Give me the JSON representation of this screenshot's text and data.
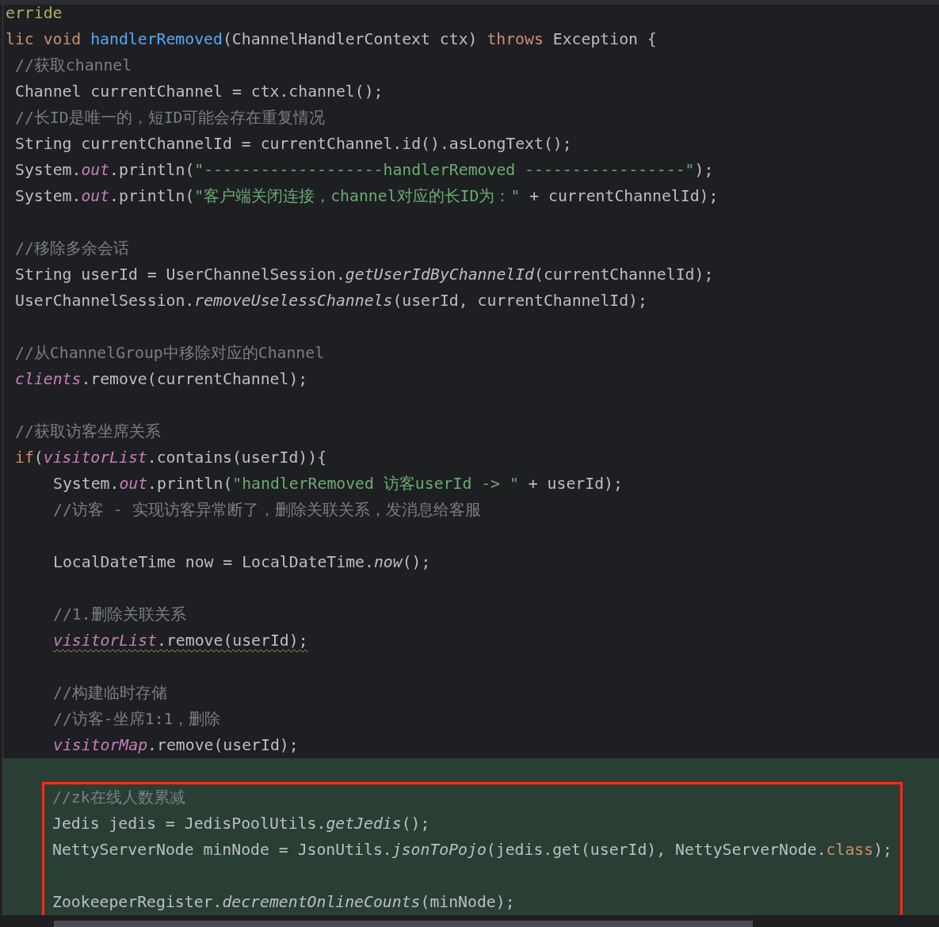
{
  "editor": {
    "lines": [
      {
        "kind": "code",
        "changed": false,
        "boxed": false,
        "tokens": [
          {
            "kind": "annotation",
            "text": "erride"
          }
        ]
      },
      {
        "kind": "code",
        "changed": false,
        "boxed": false,
        "tokens": [
          {
            "kind": "keyword",
            "text": "lic void "
          },
          {
            "kind": "declaration",
            "text": "handlerRemoved"
          },
          {
            "kind": "plain",
            "text": "(ChannelHandlerContext ctx) "
          },
          {
            "kind": "keyword",
            "text": "throws "
          },
          {
            "kind": "plain",
            "text": "Exception {"
          }
        ],
        "children": [
          {
            "kind": "code",
            "changed": false,
            "boxed": false,
            "tokens": [
              {
                "kind": "comment",
                "text": "//获取channel"
              }
            ]
          },
          {
            "kind": "code",
            "changed": false,
            "boxed": false,
            "tokens": [
              {
                "kind": "plain",
                "text": "Channel currentChannel = ctx.channel();"
              }
            ]
          },
          {
            "kind": "code",
            "changed": false,
            "boxed": false,
            "tokens": [
              {
                "kind": "comment",
                "text": "//长ID是唯一的，短ID可能会存在重复情况"
              }
            ]
          },
          {
            "kind": "code",
            "changed": false,
            "boxed": false,
            "tokens": [
              {
                "kind": "plain",
                "text": "String currentChannelId = currentChannel.id().asLongText();"
              }
            ]
          },
          {
            "kind": "code",
            "changed": false,
            "boxed": false,
            "tokens": [
              {
                "kind": "plain",
                "text": "System."
              },
              {
                "kind": "field",
                "text": "out"
              },
              {
                "kind": "plain",
                "text": ".println("
              },
              {
                "kind": "string",
                "text": "\"-------------------handlerRemoved -----------------\""
              },
              {
                "kind": "plain",
                "text": ");"
              }
            ]
          },
          {
            "kind": "code",
            "changed": false,
            "boxed": false,
            "tokens": [
              {
                "kind": "plain",
                "text": "System."
              },
              {
                "kind": "field",
                "text": "out"
              },
              {
                "kind": "plain",
                "text": ".println("
              },
              {
                "kind": "string",
                "text": "\"客户端关闭连接，channel对应的长ID为：\""
              },
              {
                "kind": "plain",
                "text": " + currentChannelId);"
              }
            ]
          },
          {
            "kind": "blank",
            "changed": false,
            "boxed": false
          },
          {
            "kind": "code",
            "changed": false,
            "boxed": false,
            "tokens": [
              {
                "kind": "comment",
                "text": "//移除多余会话"
              }
            ]
          },
          {
            "kind": "code",
            "changed": false,
            "boxed": false,
            "tokens": [
              {
                "kind": "plain",
                "text": "String userId = UserChannelSession."
              },
              {
                "kind": "static-call",
                "text": "getUserIdByChannelId"
              },
              {
                "kind": "plain",
                "text": "(currentChannelId);"
              }
            ]
          },
          {
            "kind": "code",
            "changed": false,
            "boxed": false,
            "tokens": [
              {
                "kind": "plain",
                "text": "UserChannelSession."
              },
              {
                "kind": "static-call",
                "text": "removeUselessChannels"
              },
              {
                "kind": "plain",
                "text": "(userId, currentChannelId);"
              }
            ]
          },
          {
            "kind": "blank",
            "changed": false,
            "boxed": false
          },
          {
            "kind": "code",
            "changed": false,
            "boxed": false,
            "tokens": [
              {
                "kind": "comment",
                "text": "//从ChannelGroup中移除对应的Channel"
              }
            ]
          },
          {
            "kind": "code",
            "changed": false,
            "boxed": false,
            "tokens": [
              {
                "kind": "field",
                "text": "clients"
              },
              {
                "kind": "plain",
                "text": ".remove(currentChannel);"
              }
            ]
          },
          {
            "kind": "blank",
            "changed": false,
            "boxed": false
          },
          {
            "kind": "code",
            "changed": false,
            "boxed": false,
            "tokens": [
              {
                "kind": "comment",
                "text": "//获取访客坐席关系"
              }
            ]
          },
          {
            "kind": "code",
            "changed": false,
            "boxed": false,
            "tokens": [
              {
                "kind": "keyword",
                "text": "if"
              },
              {
                "kind": "plain",
                "text": "("
              },
              {
                "kind": "field",
                "text": "visitorList"
              },
              {
                "kind": "plain",
                "text": ".contains(userId)){"
              }
            ],
            "children": [
              {
                "kind": "code",
                "changed": false,
                "boxed": false,
                "tokens": [
                  {
                    "kind": "plain",
                    "text": "System."
                  },
                  {
                    "kind": "field",
                    "text": "out"
                  },
                  {
                    "kind": "plain",
                    "text": ".println("
                  },
                  {
                    "kind": "string",
                    "text": "\"handlerRemoved 访客userId -> \""
                  },
                  {
                    "kind": "plain",
                    "text": " + userId);"
                  }
                ]
              },
              {
                "kind": "code",
                "changed": false,
                "boxed": false,
                "tokens": [
                  {
                    "kind": "comment",
                    "text": "//访客 - 实现访客异常断了，删除关联关系，发消息给客服"
                  }
                ]
              },
              {
                "kind": "blank",
                "changed": false,
                "boxed": false
              },
              {
                "kind": "code",
                "changed": false,
                "boxed": false,
                "tokens": [
                  {
                    "kind": "plain",
                    "text": "LocalDateTime now = LocalDateTime."
                  },
                  {
                    "kind": "static-call",
                    "text": "now"
                  },
                  {
                    "kind": "plain",
                    "text": "();"
                  }
                ]
              },
              {
                "kind": "blank",
                "changed": false,
                "boxed": false
              },
              {
                "kind": "code",
                "changed": false,
                "boxed": false,
                "tokens": [
                  {
                    "kind": "comment",
                    "text": "//1.删除关联关系"
                  }
                ]
              },
              {
                "kind": "code",
                "changed": false,
                "boxed": false,
                "warning": true,
                "tokens": [
                  {
                    "kind": "field",
                    "text": "visitorList"
                  },
                  {
                    "kind": "plain",
                    "text": ".remove(userId);"
                  }
                ]
              },
              {
                "kind": "blank",
                "changed": false,
                "boxed": false
              },
              {
                "kind": "code",
                "changed": false,
                "boxed": false,
                "tokens": [
                  {
                    "kind": "comment",
                    "text": "//构建临时存储"
                  }
                ]
              },
              {
                "kind": "code",
                "changed": false,
                "boxed": false,
                "tokens": [
                  {
                    "kind": "comment",
                    "text": "//访客-坐席1:1，删除"
                  }
                ]
              },
              {
                "kind": "code",
                "changed": false,
                "boxed": false,
                "tokens": [
                  {
                    "kind": "field",
                    "text": "visitorMap"
                  },
                  {
                    "kind": "plain",
                    "text": ".remove(userId);"
                  }
                ]
              },
              {
                "kind": "blank",
                "changed": true,
                "boxed": false
              },
              {
                "kind": "code",
                "changed": true,
                "boxed": true,
                "tokens": [
                  {
                    "kind": "comment",
                    "text": "//zk在线人数累减"
                  }
                ]
              },
              {
                "kind": "code",
                "changed": true,
                "boxed": true,
                "tokens": [
                  {
                    "kind": "plain",
                    "text": "Jedis jedis = JedisPoolUtils."
                  },
                  {
                    "kind": "static-call",
                    "text": "getJedis"
                  },
                  {
                    "kind": "plain",
                    "text": "();"
                  }
                ]
              },
              {
                "kind": "code",
                "changed": true,
                "boxed": true,
                "tokens": [
                  {
                    "kind": "plain",
                    "text": "NettyServerNode minNode = JsonUtils."
                  },
                  {
                    "kind": "static-call",
                    "text": "jsonToPojo"
                  },
                  {
                    "kind": "plain",
                    "text": "(jedis.get(userId), NettyServerNode."
                  },
                  {
                    "kind": "keyword",
                    "text": "class"
                  },
                  {
                    "kind": "plain",
                    "text": ");"
                  }
                ]
              },
              {
                "kind": "blank",
                "changed": true,
                "boxed": true
              },
              {
                "kind": "code",
                "changed": true,
                "boxed": true,
                "tokens": [
                  {
                    "kind": "plain",
                    "text": "ZookeeperRegister."
                  },
                  {
                    "kind": "static-call",
                    "text": "decrementOnlineCounts"
                  },
                  {
                    "kind": "plain",
                    "text": "(minNode);"
                  }
                ]
              }
            ]
          }
        ]
      }
    ]
  }
}
